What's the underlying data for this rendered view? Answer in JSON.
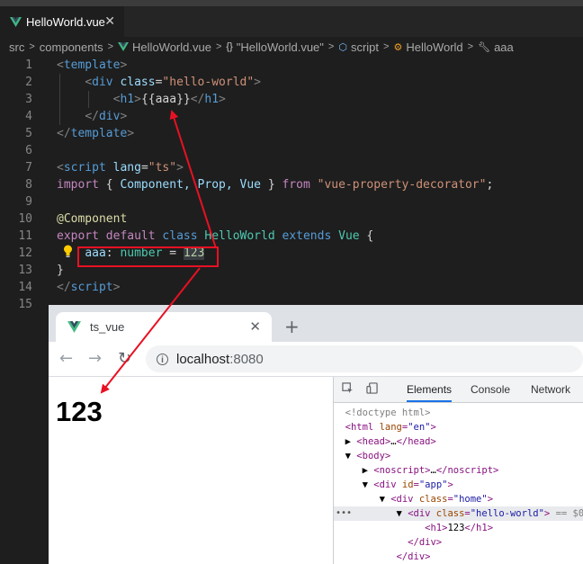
{
  "editor": {
    "tab_label": "HelloWorld.vue",
    "breadcrumb": [
      "src",
      "components",
      "HelloWorld.vue",
      "\"HelloWorld.vue\"",
      "script",
      "HelloWorld",
      "aaa"
    ],
    "line_numbers": [
      "1",
      "2",
      "3",
      "4",
      "5",
      "6",
      "7",
      "8",
      "9",
      "10",
      "11",
      "12",
      "13",
      "14",
      "15"
    ],
    "lines": {
      "l1_tag": "template",
      "l2_tag": "div",
      "l2_attr": "class",
      "l2_val": "\"hello-world\"",
      "l3_tag": "h1",
      "l3_text": "{{aaa}}",
      "l4_tag": "div",
      "l5_tag": "template",
      "l7_tag": "script",
      "l7_attr": "lang",
      "l7_val": "\"ts\"",
      "l8_import": "import",
      "l8_names": "Component, Prop, Vue",
      "l8_from": "from",
      "l8_module": "\"vue-property-decorator\"",
      "l10_decorator": "@Component",
      "l11_export": "export",
      "l11_default": "default",
      "l11_class": "class",
      "l11_name": "HelloWorld",
      "l11_extends": "extends",
      "l11_base": "Vue",
      "l12_prop": "aaa",
      "l12_type": "number",
      "l12_value": "123",
      "l14_tag": "script"
    }
  },
  "browser": {
    "tab_title": "ts_vue",
    "url_host": "localhost",
    "url_port": ":8080",
    "page_heading": "123"
  },
  "devtools": {
    "tabs": [
      "Elements",
      "Console",
      "Network"
    ],
    "active_tab": "Elements",
    "selected_suffix": "== $0"
  },
  "colors": {
    "annotation": "#e81123",
    "vue_green": "#41b883"
  }
}
